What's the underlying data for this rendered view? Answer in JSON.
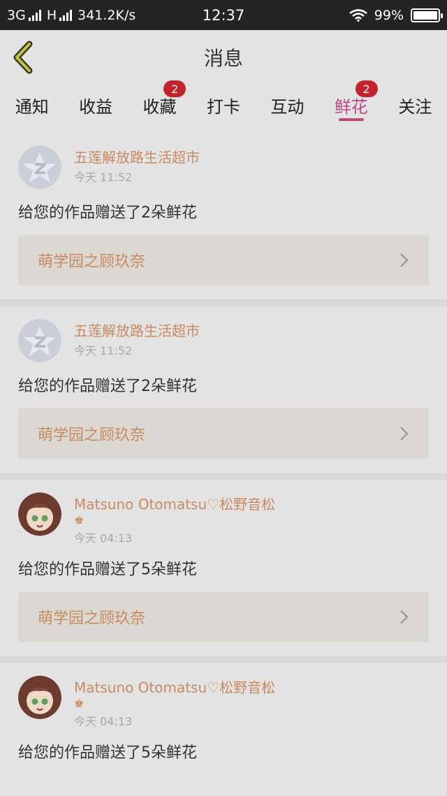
{
  "statusbar": {
    "network": "3G",
    "signal2_label": "H",
    "speed": "341.2K/s",
    "time": "12:37",
    "battery": "99%"
  },
  "header": {
    "title": "消息"
  },
  "tabs": [
    {
      "label": "通知",
      "badge": ""
    },
    {
      "label": "收益",
      "badge": ""
    },
    {
      "label": "收藏",
      "badge": "2"
    },
    {
      "label": "打卡",
      "badge": ""
    },
    {
      "label": "互动",
      "badge": ""
    },
    {
      "label": "鲜花",
      "badge": "2",
      "active": true
    },
    {
      "label": "关注",
      "badge": ""
    }
  ],
  "messages": [
    {
      "user": "五莲解放路生活超市",
      "crown": "",
      "time": "今天 11:52",
      "text": "给您的作品赠送了2朵鲜花",
      "work": "萌学园之顾玖奈",
      "avatar": "default-avatar"
    },
    {
      "user": "五莲解放路生活超市",
      "crown": "",
      "time": "今天 11:52",
      "text": "给您的作品赠送了2朵鲜花",
      "work": "萌学园之顾玖奈",
      "avatar": "default-avatar"
    },
    {
      "user": "Matsuno Otomatsu♡松野音松",
      "crown": "♚",
      "time": "今天 04:13",
      "text": "给您的作品赠送了5朵鲜花",
      "work": "萌学园之顾玖奈",
      "avatar": "anime-avatar"
    },
    {
      "user": "Matsuno Otomatsu♡松野音松",
      "crown": "♚",
      "time": "今天 04:13",
      "text": "给您的作品赠送了5朵鲜花",
      "work": "",
      "avatar": "anime-avatar"
    }
  ],
  "colors": {
    "accent": "#c0497a",
    "badge": "#c4232e",
    "name": "#c98a62"
  }
}
